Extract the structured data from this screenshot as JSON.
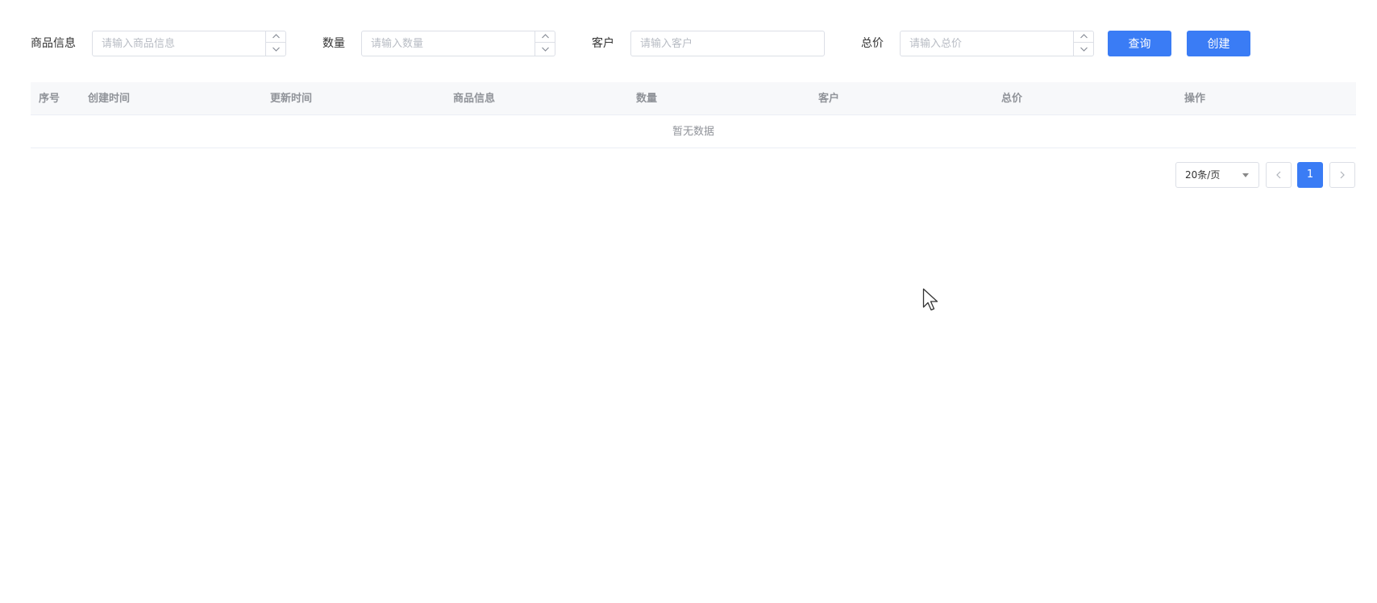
{
  "filters": {
    "product": {
      "label": "商品信息",
      "placeholder": "请输入商品信息"
    },
    "quantity": {
      "label": "数量",
      "placeholder": "请输入数量"
    },
    "customer": {
      "label": "客户",
      "placeholder": "请输入客户"
    },
    "total": {
      "label": "总价",
      "placeholder": "请输入总价"
    },
    "query_label": "查询",
    "create_label": "创建"
  },
  "table": {
    "columns": [
      "序号",
      "创建时间",
      "更新时间",
      "商品信息",
      "数量",
      "客户",
      "总价",
      "操作"
    ],
    "empty_text": "暂无数据"
  },
  "pagination": {
    "page_size": "20条/页",
    "current_page": "1"
  },
  "colors": {
    "primary": "#3a7cf5",
    "header_bg": "#f7f8fa",
    "border": "#dcdfe6"
  },
  "icons": [
    "chevron-up-icon",
    "chevron-down-icon",
    "caret-down-icon",
    "chevron-left-icon",
    "chevron-right-icon",
    "mouse-cursor-icon"
  ]
}
